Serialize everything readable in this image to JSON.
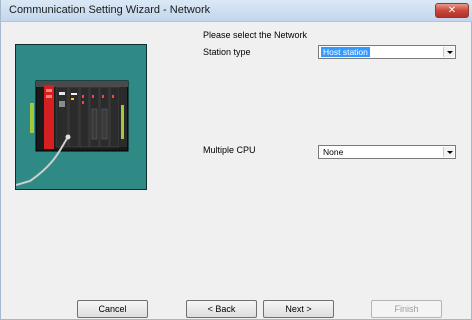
{
  "window": {
    "title": "Communication Setting Wizard - Network",
    "close_glyph": "✕"
  },
  "image": {
    "icon": "plc-hardware-image",
    "background_color": "#2f8a86"
  },
  "form": {
    "prompt": "Please select the Network",
    "station_type": {
      "label": "Station type",
      "value": "Host station",
      "selected_highlight_color": "#3399ff"
    },
    "multiple_cpu": {
      "label": "Multiple CPU",
      "value": "None"
    }
  },
  "buttons": {
    "cancel": "Cancel",
    "back": "< Back",
    "next": "Next >",
    "finish": "Finish"
  }
}
